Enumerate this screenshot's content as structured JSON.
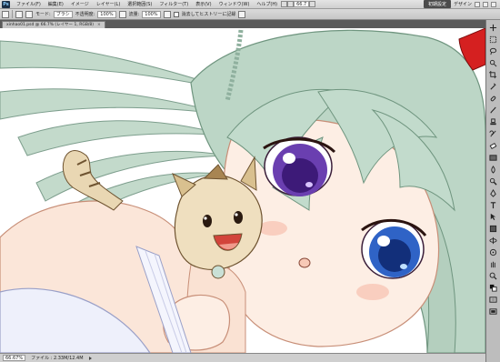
{
  "app": {
    "logo": "Ps"
  },
  "menubar": {
    "items": [
      "ファイル(F)",
      "編集(E)",
      "イメージ",
      "レイヤー(L)",
      "選択範囲(S)",
      "フィルター(T)",
      "表示(V)",
      "ウィンドウ(W)",
      "ヘルプ(H)"
    ],
    "zoom": "66.7",
    "workspace_button": "初期設定",
    "workspace_label": "デザイン"
  },
  "optionsbar": {
    "mode_label": "モード:",
    "mode_value": "ブラシ",
    "opacity_label": "不透明度:",
    "opacity_value": "100%",
    "flow_label": "流量:",
    "flow_value": "100%",
    "erase_history_label": "消去してヒストリーに記録"
  },
  "document": {
    "tab_title": "xinhao01.psd @ 66.7% (レイヤー 1, RGB/8)",
    "close": "×"
  },
  "statusbar": {
    "zoom": "66.67%",
    "doc_info": "ファイル : 2.33M/12.4M"
  },
  "colors": {
    "hair": "#b9d3c4",
    "hair_shadow": "#7ba08f",
    "skin": "#fbe6d9",
    "skin_shadow": "#f0c3ac",
    "left_eye": "#6a3fb0",
    "right_eye": "#2f63c6",
    "ribbon": "#d52020",
    "creature": "#e9d7b3",
    "creature_stripe": "#6e5330"
  },
  "tools": [
    "move-icon",
    "marquee-icon",
    "lasso-icon",
    "quick-select-icon",
    "crop-icon",
    "eyedropper-icon",
    "healing-icon",
    "brush-icon",
    "stamp-icon",
    "history-brush-icon",
    "eraser-icon",
    "gradient-icon",
    "blur-icon",
    "dodge-icon",
    "pen-icon",
    "type-icon",
    "path-select-icon",
    "shape-icon",
    "3d-rotate-icon",
    "3d-orbit-icon",
    "hand-icon",
    "zoom-icon",
    "color-swatch-icon",
    "quickmask-icon",
    "screen-mode-icon"
  ]
}
